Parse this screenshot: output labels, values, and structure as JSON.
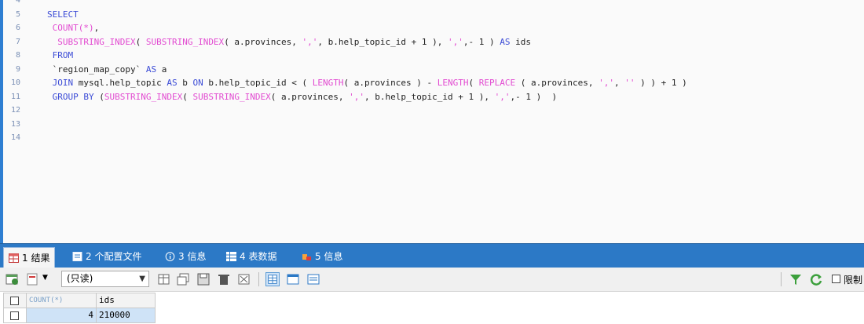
{
  "editor": {
    "lines": [
      {
        "n": "4",
        "html": ""
      },
      {
        "n": "5",
        "parts": [
          {
            "t": "SELECT",
            "c": "kw"
          }
        ]
      },
      {
        "n": "6",
        "parts": [
          {
            "t": " COUNT",
            "c": "fn"
          },
          {
            "t": "(*)",
            "c": "str"
          },
          {
            "t": ",",
            "c": ""
          }
        ]
      },
      {
        "n": "7",
        "parts": [
          {
            "t": "  SUBSTRING_INDEX",
            "c": "fn"
          },
          {
            "t": "( ",
            "c": ""
          },
          {
            "t": "SUBSTRING_INDEX",
            "c": "fn"
          },
          {
            "t": "( a.provinces, ",
            "c": ""
          },
          {
            "t": "','",
            "c": "str"
          },
          {
            "t": ", b.help_topic_id + 1 ), ",
            "c": ""
          },
          {
            "t": "','",
            "c": "str"
          },
          {
            "t": ",- 1 ) ",
            "c": ""
          },
          {
            "t": "AS",
            "c": "kw"
          },
          {
            "t": " ids",
            "c": ""
          }
        ]
      },
      {
        "n": "8",
        "parts": [
          {
            "t": " FROM",
            "c": "kw"
          }
        ]
      },
      {
        "n": "9",
        "parts": [
          {
            "t": " `region_map_copy` ",
            "c": ""
          },
          {
            "t": "AS",
            "c": "kw"
          },
          {
            "t": " a",
            "c": ""
          }
        ]
      },
      {
        "n": "10",
        "parts": [
          {
            "t": " JOIN",
            "c": "kw"
          },
          {
            "t": " mysql.help_topic ",
            "c": ""
          },
          {
            "t": "AS",
            "c": "kw"
          },
          {
            "t": " b ",
            "c": ""
          },
          {
            "t": "ON",
            "c": "kw"
          },
          {
            "t": " b.help_topic_id < ( ",
            "c": ""
          },
          {
            "t": "LENGTH",
            "c": "fn"
          },
          {
            "t": "( a.provinces ) - ",
            "c": ""
          },
          {
            "t": "LENGTH",
            "c": "fn"
          },
          {
            "t": "( ",
            "c": ""
          },
          {
            "t": "REPLACE",
            "c": "fn"
          },
          {
            "t": " ( a.provinces, ",
            "c": ""
          },
          {
            "t": "','",
            "c": "str"
          },
          {
            "t": ", ",
            "c": ""
          },
          {
            "t": "''",
            "c": "str"
          },
          {
            "t": " ) ) + 1 )",
            "c": ""
          }
        ]
      },
      {
        "n": "11",
        "parts": [
          {
            "t": " GROUP BY",
            "c": "kw"
          },
          {
            "t": " (",
            "c": ""
          },
          {
            "t": "SUBSTRING_INDEX",
            "c": "fn"
          },
          {
            "t": "( ",
            "c": ""
          },
          {
            "t": "SUBSTRING_INDEX",
            "c": "fn"
          },
          {
            "t": "( a.provinces, ",
            "c": ""
          },
          {
            "t": "','",
            "c": "str"
          },
          {
            "t": ", b.help_topic_id + 1 ), ",
            "c": ""
          },
          {
            "t": "','",
            "c": "str"
          },
          {
            "t": ",- 1 )  )",
            "c": ""
          }
        ]
      },
      {
        "n": "12",
        "parts": []
      },
      {
        "n": "13",
        "parts": []
      },
      {
        "n": "14",
        "parts": []
      }
    ]
  },
  "tabs": [
    {
      "label": "1 结果",
      "active": true
    },
    {
      "label": "2 个配置文件",
      "active": false
    },
    {
      "label": "3 信息",
      "active": false
    },
    {
      "label": "4 表数据",
      "active": false
    },
    {
      "label": "5 信息",
      "active": false
    }
  ],
  "toolbar": {
    "mode_select": "(只读)",
    "limit_label": "限制"
  },
  "grid": {
    "columns": [
      "COUNT(*)",
      "ids"
    ],
    "rows": [
      [
        "4",
        "210000"
      ]
    ]
  },
  "colors": {
    "keyword": "#3b4bd6",
    "function": "#e24bd1",
    "tab_bar": "#2c79c6",
    "selected_cell": "#cfe3f7"
  }
}
